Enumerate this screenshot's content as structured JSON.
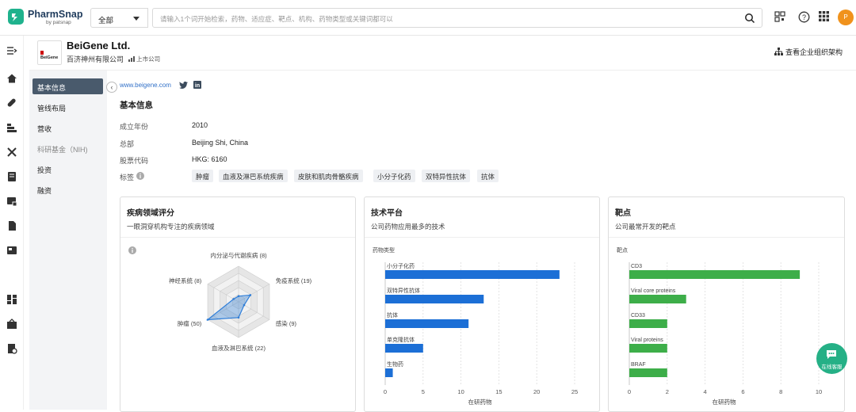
{
  "app": {
    "name": "PharmSnap",
    "byline": "by patsnap"
  },
  "search": {
    "scope": "全部",
    "placeholder": "请输入1个词开始检索，药物、适应症、靶点、机构、药物类型或关键词都可以"
  },
  "user": {
    "initial": "P"
  },
  "company": {
    "name_en": "BeiGene Ltd.",
    "name_cn": "百济神州有限公司",
    "listed": "上市公司",
    "logo_text": "BeiGene",
    "org_link": "查看企业组织架构"
  },
  "menu": [
    {
      "label": "基本信息",
      "state": "active"
    },
    {
      "label": "管线布局",
      "state": "normal"
    },
    {
      "label": "营收",
      "state": "normal"
    },
    {
      "label": "科研基金（NIH)",
      "state": "disabled"
    },
    {
      "label": "投资",
      "state": "normal"
    },
    {
      "label": "融资",
      "state": "normal"
    }
  ],
  "website": "www.beigene.com",
  "basic": {
    "title": "基本信息",
    "rows": [
      {
        "k": "成立年份",
        "v": "2010"
      },
      {
        "k": "总部",
        "v": "Beijing Shi, China"
      },
      {
        "k": "股票代码",
        "v": "HKG: 6160"
      }
    ],
    "tags_label": "标签",
    "tags": [
      "肿瘤",
      "血液及淋巴系统疾病",
      "皮肤和肌肉骨骼疾病",
      "小分子化药",
      "双特异性抗体",
      "抗体"
    ]
  },
  "cards": {
    "disease": {
      "title": "疾病领域评分",
      "sub": "一眼洞穿机构专注的疾病领域"
    },
    "tech": {
      "title": "技术平台",
      "sub": "公司药物应用最多的技术"
    },
    "target": {
      "title": "靶点",
      "sub": "公司最常开发的靶点"
    }
  },
  "chat": {
    "label": "在线客服"
  },
  "chart_data": [
    {
      "type": "radar",
      "axes": [
        "内分泌与代谢疾病 (8)",
        "免疫系统 (19)",
        "感染 (9)",
        "血液及淋巴系统 (22)",
        "肿瘤 (50)",
        "神经系统 (8)"
      ],
      "values": [
        8,
        19,
        9,
        22,
        50,
        8
      ],
      "max": 50,
      "color": "#2f7ed8"
    },
    {
      "type": "bar",
      "orientation": "horizontal",
      "ylabel": "药物类型",
      "xlabel": "在研药物",
      "categories": [
        "小分子化药",
        "双特异性抗体",
        "抗体",
        "单克隆抗体",
        "生物药"
      ],
      "values": [
        23,
        13,
        11,
        5,
        1
      ],
      "xlim": [
        0,
        25
      ],
      "ticks": [
        0,
        5,
        10,
        15,
        20,
        25
      ],
      "color": "#1c6fd6"
    },
    {
      "type": "bar",
      "orientation": "horizontal",
      "ylabel": "靶点",
      "xlabel": "在研药物",
      "categories": [
        "CD3",
        "Viral core proteins",
        "CD33",
        "Viral proteins",
        "BRAF"
      ],
      "values": [
        9,
        3,
        2,
        2,
        2
      ],
      "xlim": [
        0,
        10
      ],
      "ticks": [
        0,
        2,
        4,
        6,
        8,
        10
      ],
      "color": "#3dae49"
    }
  ]
}
